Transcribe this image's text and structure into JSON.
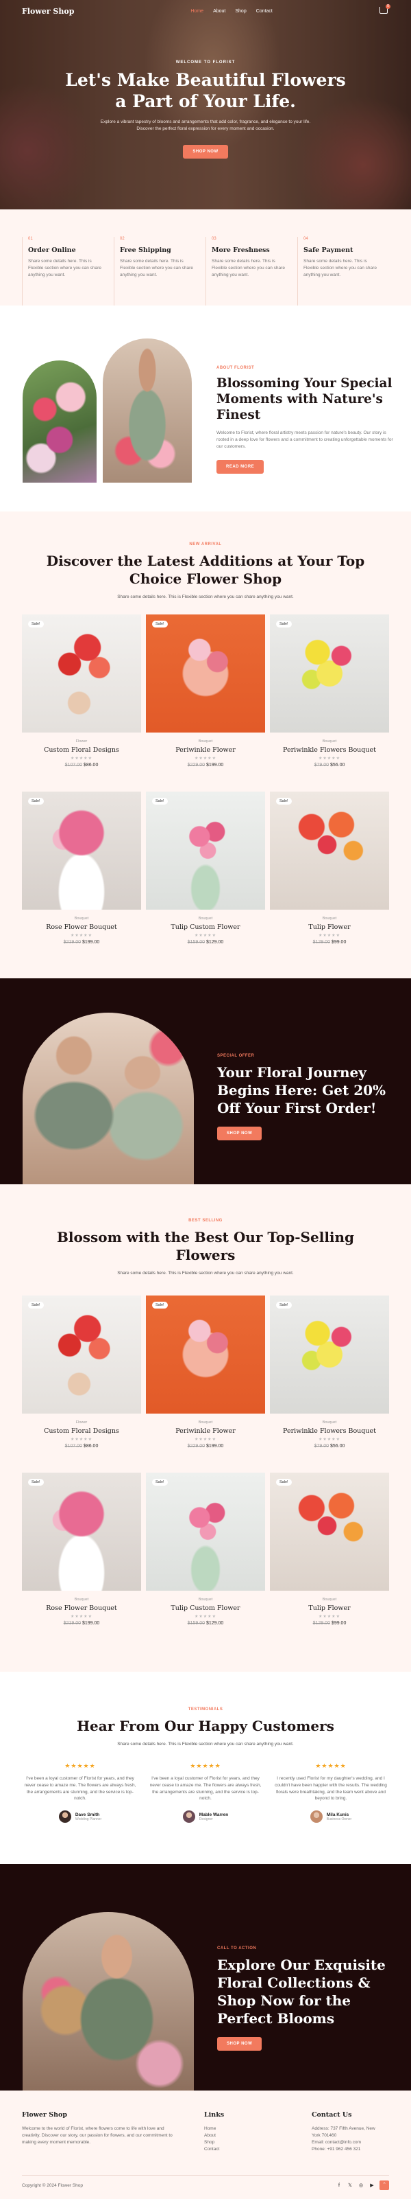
{
  "nav": {
    "logo": "Flower Shop",
    "links": [
      "Home",
      "About",
      "Shop",
      "Contact"
    ],
    "cart_count": "0"
  },
  "hero": {
    "eyebrow": "WELCOME TO FLORIST",
    "title_line1": "Let's Make Beautiful Flowers",
    "title_line2": "a Part of Your Life.",
    "desc_line1": "Explore a vibrant tapestry of blooms and arrangements that add color, fragrance, and elegance to your life.",
    "desc_line2": "Discover the perfect floral expression for every moment and occasion.",
    "button": "SHOP NOW"
  },
  "features": [
    {
      "num": "01",
      "title": "Order Online",
      "text": "Share some details here. This is Flexible section where you can share anything you want."
    },
    {
      "num": "02",
      "title": "Free Shipping",
      "text": "Share some details here. This is Flexible section where you can share anything you want."
    },
    {
      "num": "03",
      "title": "More Freshness",
      "text": "Share some details here. This is Flexible section where you can share anything you want."
    },
    {
      "num": "04",
      "title": "Safe Payment",
      "text": "Share some details here. This is Flexible section where you can share anything you want."
    }
  ],
  "about": {
    "kicker": "ABOUT FLORIST",
    "title": "Blossoming Your Special Moments with Nature's Finest",
    "text": "Welcome to Florist, where floral artistry meets passion for nature's beauty. Our story is rooted in a deep love for flowers and a commitment to creating unforgettable moments for our customers.",
    "button": "READ MORE"
  },
  "new_arrival": {
    "kicker": "NEW ARRIVAL",
    "title_line1": "Discover the Latest Additions at Your Top",
    "title_line2": "Choice Flower Shop",
    "subtitle": "Share some details here. This is Flexible section where you can share anything you want."
  },
  "products": [
    {
      "sale": "Sale!",
      "cat": "Flower",
      "name": "Custom Floral Designs",
      "old": "$107.00",
      "price": "$86.00"
    },
    {
      "sale": "Sale!",
      "cat": "Bouquet",
      "name": "Periwinkle Flower",
      "old": "$229.00",
      "price": "$199.00"
    },
    {
      "sale": "Sale!",
      "cat": "Bouquet",
      "name": "Periwinkle Flowers Bouquet",
      "old": "$79.00",
      "price": "$56.00"
    },
    {
      "sale": "Sale!",
      "cat": "Bouquet",
      "name": "Rose Flower Bouquet",
      "old": "$219.00",
      "price": "$199.00"
    },
    {
      "sale": "Sale!",
      "cat": "Bouquet",
      "name": "Tulip Custom Flower",
      "old": "$159.00",
      "price": "$129.00"
    },
    {
      "sale": "Sale!",
      "cat": "Bouquet",
      "name": "Tulip Flower",
      "old": "$129.00",
      "price": "$99.00"
    }
  ],
  "stars": "★★★★★",
  "offer": {
    "kicker": "SPECIAL OFFER",
    "title": "Your Floral Journey Begins Here: Get 20% Off Your First Order!",
    "button": "SHOP NOW"
  },
  "best_selling": {
    "kicker": "BEST SELLING",
    "title_line1": "Blossom with the Best Our Top-Selling",
    "title_line2": "Flowers",
    "subtitle": "Share some details here. This is Flexible section where you can share anything you want."
  },
  "testimonials": {
    "kicker": "TESTIMONIALS",
    "title": "Hear From Our Happy Customers",
    "subtitle": "Share some details here. This is Flexible section where you can share anything you want.",
    "items": [
      {
        "quote": "I've been a loyal customer of Florist for years, and they never cease to amaze me. The flowers are always fresh, the arrangements are stunning, and the service is top-notch.",
        "name": "Dave Smith",
        "role": "Wedding Planner"
      },
      {
        "quote": "I've been a loyal customer of Florist for years, and they never cease to amaze me. The flowers are always fresh, the arrangements are stunning, and the service is top-notch.",
        "name": "Mable Warren",
        "role": "Designer"
      },
      {
        "quote": "I recently used Florist for my daughter's wedding, and I couldn't have been happier with the results. The wedding florals were breathtaking, and the team went above and beyond to bring.",
        "name": "Mila Kunis",
        "role": "Business Owner"
      }
    ]
  },
  "cta": {
    "kicker": "CALL TO ACTION",
    "title": "Explore Our Exquisite Floral Collections & Shop Now for the Perfect Blooms",
    "button": "SHOP NOW"
  },
  "footer": {
    "brand": "Flower Shop",
    "about": "Welcome to the world of Florist, where flowers come to life with love and creativity. Discover our story, our passion for flowers, and our commitment to making every moment memorable.",
    "links_title": "Links",
    "links": [
      "Home",
      "About",
      "Shop",
      "Contact"
    ],
    "contact_title": "Contact Us",
    "address_line1": "Address: 737 Fifth Avenue, New",
    "address_line2": "York 701460",
    "email": "Email: contact@info.com",
    "phone": "Phone: +91 962 456 321",
    "copyright": "Copyright © 2024 Flower Shop"
  },
  "colors": {
    "accent": "#f27a5e",
    "dark": "#1e0a0a",
    "blush": "#fff5f2"
  }
}
